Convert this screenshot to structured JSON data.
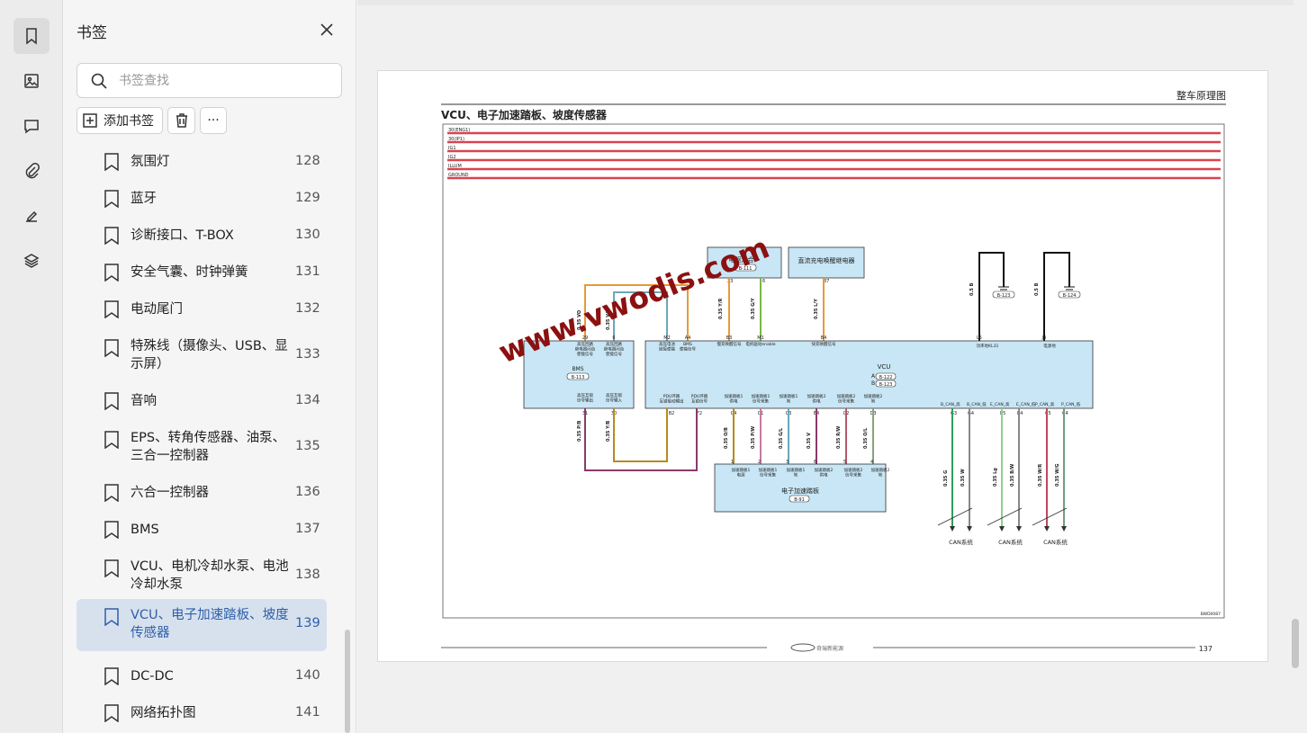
{
  "sidebar": {
    "title": "书签",
    "search_placeholder": "书签查找",
    "add_label": "添加书签",
    "more_label": "···",
    "rail": [
      "bookmark-icon",
      "image-icon",
      "comment-icon",
      "attachment-icon",
      "signature-icon",
      "layers-icon"
    ],
    "items": [
      {
        "label": "氛围灯",
        "page": "128"
      },
      {
        "label": "蓝牙",
        "page": "129"
      },
      {
        "label": "诊断接口、T-BOX",
        "page": "130"
      },
      {
        "label": "安全气囊、时钟弹簧",
        "page": "131"
      },
      {
        "label": "电动尾门",
        "page": "132"
      },
      {
        "label": "特殊线（摄像头、USB、显示屏）",
        "page": "133"
      },
      {
        "label": "音响",
        "page": "134"
      },
      {
        "label": "EPS、转角传感器、油泵、三合一控制器",
        "page": "135"
      },
      {
        "label": "六合一控制器",
        "page": "136"
      },
      {
        "label": "BMS",
        "page": "137"
      },
      {
        "label": "VCU、电机冷却水泵、电池冷却水泵",
        "page": "138"
      },
      {
        "label": "VCU、电子加速踏板、坡度传感器",
        "page": "139"
      },
      {
        "label": "DC-DC",
        "page": "140"
      },
      {
        "label": "网络拓扑图",
        "page": "141"
      }
    ],
    "active_index": 11
  },
  "document": {
    "header_right": "整车原理图",
    "title": "VCU、电子加速踏板、坡度传感器",
    "page_number": "137",
    "watermark": "www.vwodis.com",
    "code": "BWD0087",
    "footer_logo_text": "奇瑞新能源",
    "power_rails": [
      "30(ENG1)",
      "30(IP1)",
      "IG1",
      "IG2",
      "ILLUM",
      "GROUND"
    ],
    "modules": {
      "six_in_one": {
        "name": "电驱六合一",
        "conn": "B-111"
      },
      "dc_relay": {
        "name": "直流充电唤醒继电器"
      },
      "bms": {
        "name": "BMS",
        "conn": "B-113"
      },
      "vcu": {
        "name": "VCU",
        "conn_a_label": "A",
        "conn_a": "B-122",
        "conn_b_label": "B",
        "conn_b": "B-123"
      },
      "pedal": {
        "name": "电子加速踏板",
        "conn": "B-91"
      }
    },
    "grounds": [
      {
        "conn": "B-123",
        "wire": "0.5 B",
        "pin": "L5",
        "signal": "功率地KL31"
      },
      {
        "conn": "B-124",
        "wire": "0.5 B",
        "pin": "J3",
        "signal": "电源地"
      }
    ],
    "bms_pins": [
      {
        "pin": "29",
        "label": "高压回路\n继电器闭合\n使能信号"
      },
      {
        "pin": "6",
        "label": "高压回路\n继电器闭合\n使能信号"
      },
      {
        "pin": "31",
        "label": "高压互锁\n信号输出"
      },
      {
        "pin": "30",
        "label": "高压互锁\n信号输入"
      }
    ],
    "vcu_top_pins": [
      {
        "pin": "M2",
        "label": "高压电池\n链接使能"
      },
      {
        "pin": "A4",
        "label": "BMS\n使能信号"
      },
      {
        "pin": "B3",
        "label": "慢充唤醒信号"
      },
      {
        "pin": "M1",
        "label": "电机驱动enable"
      },
      {
        "pin": "B4",
        "label": "快充唤醒信号"
      }
    ],
    "vcu_bottom_pins": [
      {
        "pin": "B2",
        "label": "PDU环路\n互锁驱动输出"
      },
      {
        "pin": "F2",
        "label": "PDU环路\n互锁信号"
      },
      {
        "pin": "C4",
        "label": "加速踏板1\n供电"
      },
      {
        "pin": "C1",
        "label": "加速踏板1\n信号采集"
      },
      {
        "pin": "C3",
        "label": "加速踏板1\n地"
      },
      {
        "pin": "E4",
        "label": "加速踏板2\n供电"
      },
      {
        "pin": "C2",
        "label": "加速踏板2\n信号采集"
      },
      {
        "pin": "D3",
        "label": "加速踏板2\n地"
      }
    ],
    "pedal_pins": [
      {
        "pin": "1",
        "label": "加速踏板1\n电源"
      },
      {
        "pin": "2",
        "label": "加速踏板1\n信号采集"
      },
      {
        "pin": "3",
        "label": "加速踏板1\n地"
      },
      {
        "pin": "6",
        "label": "加速踏板2\n供电"
      },
      {
        "pin": "5",
        "label": "加速踏板2\n信号采集"
      },
      {
        "pin": "4",
        "label": "加速踏板2\n地"
      }
    ],
    "wires": [
      "0.35 VO",
      "0.35 V/L",
      "0.35 Y/R",
      "0.35 G/Y",
      "0.35 L/Y",
      "0.35 P/B",
      "0.35 Y/B",
      "0.35 O/B",
      "0.35 P/W",
      "0.35 G/L",
      "0.35 V",
      "0.35 R/W",
      "0.35 O/L"
    ],
    "can": {
      "groups": [
        {
          "labels": [
            "B_CAN_高",
            "B_CAN_低"
          ],
          "pins": [
            "G3",
            "G4"
          ],
          "wires": [
            "0.35 G",
            "0.35 W"
          ],
          "system": "CAN系统"
        },
        {
          "labels": [
            "E_CAN_高",
            "E_CAN_低"
          ],
          "pins": [
            "E5",
            "E4"
          ],
          "wires": [
            "0.35 Lg",
            "0.35 B/W"
          ],
          "system": "CAN系统"
        },
        {
          "labels": [
            "P_CAN_高",
            "P_CAN_低"
          ],
          "pins": [
            "C5",
            "C4"
          ],
          "wires": [
            "0.35 W/R",
            "0.35 W/G"
          ],
          "system": "CAN系统"
        }
      ]
    },
    "six_in_one_pins": [
      "23",
      "6"
    ],
    "relay_pin": "87"
  },
  "colors": {
    "rail_red": "#d9434f",
    "module_fill": "#c8e6f5",
    "wire_orange": "#e89a38",
    "wire_teal": "#6aa7b8",
    "wire_green": "#7ab648",
    "wire_purple": "#8a3a6b",
    "wire_gold": "#b88a1e",
    "watermark": "#8b1111",
    "active_bg": "#d7e1ee",
    "active_text": "#2f5fa8"
  }
}
